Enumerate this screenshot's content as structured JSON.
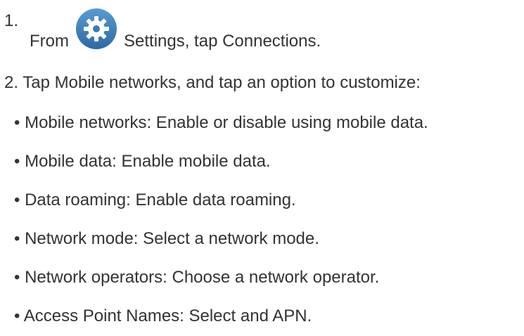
{
  "steps": {
    "step1": {
      "number": "1.",
      "from": "From",
      "icon": "settings-gear-icon",
      "rest": "Settings, tap Connections."
    },
    "step2": {
      "text": "2. Tap Mobile networks, and tap an option to customize:"
    }
  },
  "bullets": [
    "• Mobile networks: Enable or disable using mobile data.",
    "• Mobile data: Enable mobile data.",
    "• Data roaming: Enable data roaming.",
    "• Network mode: Select a network mode.",
    "• Network operators: Choose a network operator.",
    "• Access Point Names: Select and APN."
  ],
  "colors": {
    "text": "#333333",
    "icon_blue": "#2f6fa9",
    "icon_blue_light": "#4f8fc6"
  }
}
